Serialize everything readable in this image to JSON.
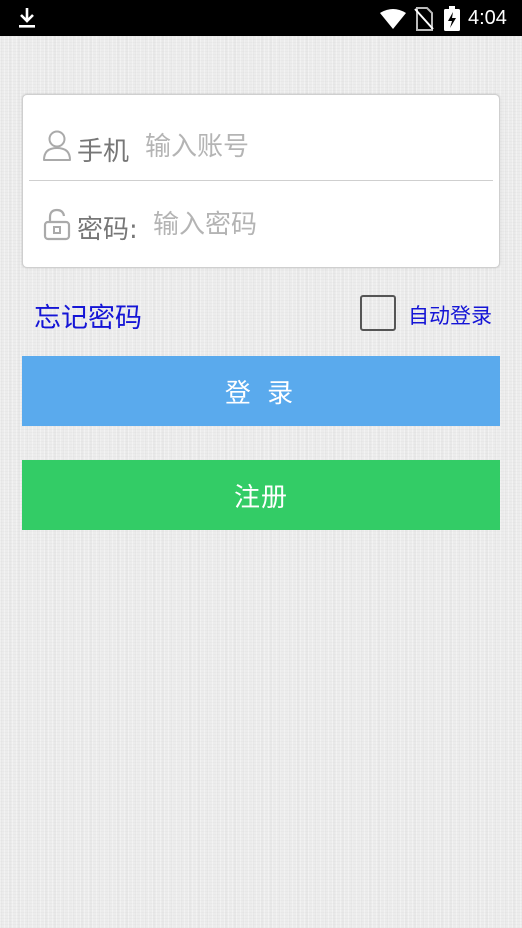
{
  "status_bar": {
    "time": "4:04",
    "icons": [
      "download-icon",
      "wifi-icon",
      "no-sim-icon",
      "battery-charging-icon"
    ]
  },
  "login_form": {
    "phone": {
      "icon": "user-icon",
      "label": "手机",
      "placeholder": "输入账号",
      "value": ""
    },
    "password": {
      "icon": "lock-icon",
      "label": "密码:",
      "placeholder": "输入密码",
      "value": ""
    }
  },
  "options": {
    "forgot_password": "忘记密码",
    "auto_login_label": "自动登录",
    "auto_login_checked": false
  },
  "buttons": {
    "login": "登 录",
    "register": "注册"
  },
  "colors": {
    "login_button": "#5aaaed",
    "register_button": "#33cc66",
    "link_text": "#1515d6"
  }
}
